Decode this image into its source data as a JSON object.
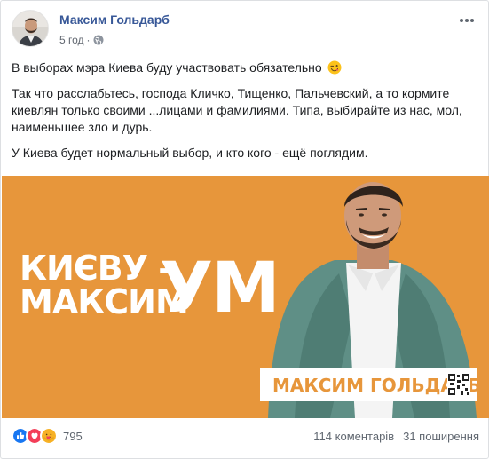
{
  "post": {
    "author": "Максим Гольдарб",
    "time": "5 год",
    "dot": "·",
    "paragraphs": [
      "В выборах мэра Киева буду участвовать обязательно",
      "Так что расслабьтесь, господа Кличко, Тищенко, Пальчевский, а то кормите киевлян только своими ...лицами и фамилиями. Типа, выбирайте из нас, мол, наименьшее зло и дурь.",
      "У Киева будет нормальный выбор, и кто кого - ещё поглядим."
    ],
    "emoji": "wink-emoji"
  },
  "image": {
    "slogan_line1": "КИЄВУ –",
    "slogan_line2": "МАКСИМ",
    "slogan_um": "УМ",
    "plate_name": "МАКСИМ ГОЛЬДАРБ",
    "bg_color": "#e7963b"
  },
  "footer": {
    "reaction_count": "795",
    "comments": "114 коментарів",
    "shares": "31 поширення",
    "reaction_icons": [
      "like-icon",
      "love-icon",
      "care-icon"
    ]
  },
  "colors": {
    "link": "#385898",
    "muted": "#606770",
    "accent": "#e7963b"
  }
}
